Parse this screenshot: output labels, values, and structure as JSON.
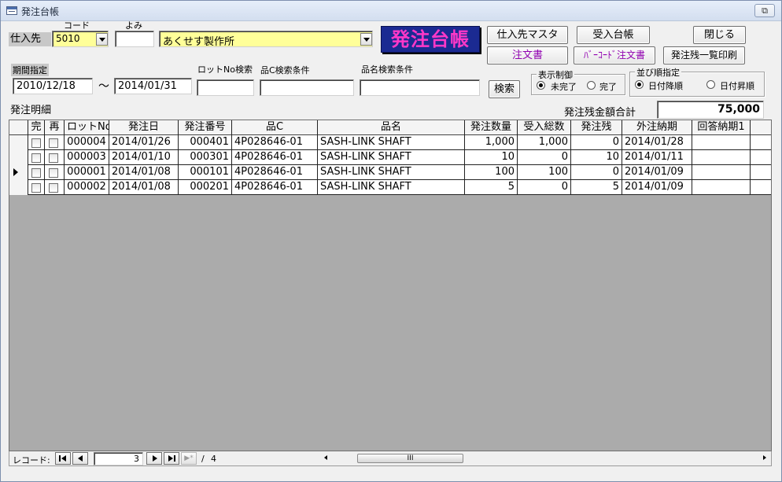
{
  "window": {
    "title": "発注台帳",
    "restore_glyph": "⧉"
  },
  "header": {
    "supplier_label": "仕入先",
    "code_label": "コード",
    "yomi_label": "よみ",
    "supplier_code": "5010",
    "yomi_value": "",
    "supplier_name": "あくせす製作所",
    "big_title": "発注台帳"
  },
  "buttons": {
    "supplier_master": "仕入先マスタ",
    "receipt_ledger": "受入台帳",
    "close": "閉じる",
    "order_form": "注文書",
    "barcode_order": "ﾊﾞｰｺｰﾄﾞ注文書",
    "print_list": "発注残一覧印刷",
    "search": "検索"
  },
  "filters": {
    "period_label": "期間指定",
    "date_from": "2010/12/18",
    "tilde": "～",
    "date_to": "2014/01/31",
    "lot_search_label": "ロットNo検索",
    "partc_search_label": "品C検索条件",
    "partname_search_label": "品名検索条件",
    "lot_search_value": "",
    "partc_search_value": "",
    "partname_search_value": ""
  },
  "display_control": {
    "label": "表示制御",
    "options": [
      "未完了",
      "完了"
    ],
    "selected": "未完了"
  },
  "sort_order": {
    "label": "並び順指定",
    "options": [
      "日付降順",
      "日付昇順"
    ],
    "selected": "日付降順"
  },
  "details": {
    "label": "発注明細",
    "total_label": "発注残金額合計",
    "total_value": "75,000"
  },
  "table": {
    "columns": [
      "完",
      "再",
      "ロットNo",
      "発注日",
      "発注番号",
      "品C",
      "品名",
      "発注数量",
      "受入総数",
      "発注残",
      "外注納期",
      "回答納期1"
    ],
    "rows": [
      {
        "lot": "000004",
        "order_date": "2014/01/26",
        "order_no": "000401",
        "part_c": "4P028646-01",
        "part_name": "SASH-LINK  SHAFT",
        "qty": "1,000",
        "received": "1,000",
        "remaining": "0",
        "due": "2014/01/28",
        "answer": ""
      },
      {
        "lot": "000003",
        "order_date": "2014/01/10",
        "order_no": "000301",
        "part_c": "4P028646-01",
        "part_name": "SASH-LINK  SHAFT",
        "qty": "10",
        "received": "0",
        "remaining": "10",
        "due": "2014/01/11",
        "answer": ""
      },
      {
        "lot": "000001",
        "order_date": "2014/01/08",
        "order_no": "000101",
        "part_c": "4P028646-01",
        "part_name": "SASH-LINK  SHAFT",
        "qty": "100",
        "received": "100",
        "remaining": "0",
        "due": "2014/01/09",
        "answer": ""
      },
      {
        "lot": "000002",
        "order_date": "2014/01/08",
        "order_no": "000201",
        "part_c": "4P028646-01",
        "part_name": "SASH-LINK  SHAFT",
        "qty": "5",
        "received": "0",
        "remaining": "5",
        "due": "2014/01/09",
        "answer": ""
      }
    ]
  },
  "navigator": {
    "label": "レコード:",
    "current": "3",
    "separator": "/",
    "total": "4",
    "new_glyph": "▶*",
    "scroll_grip": "III"
  }
}
